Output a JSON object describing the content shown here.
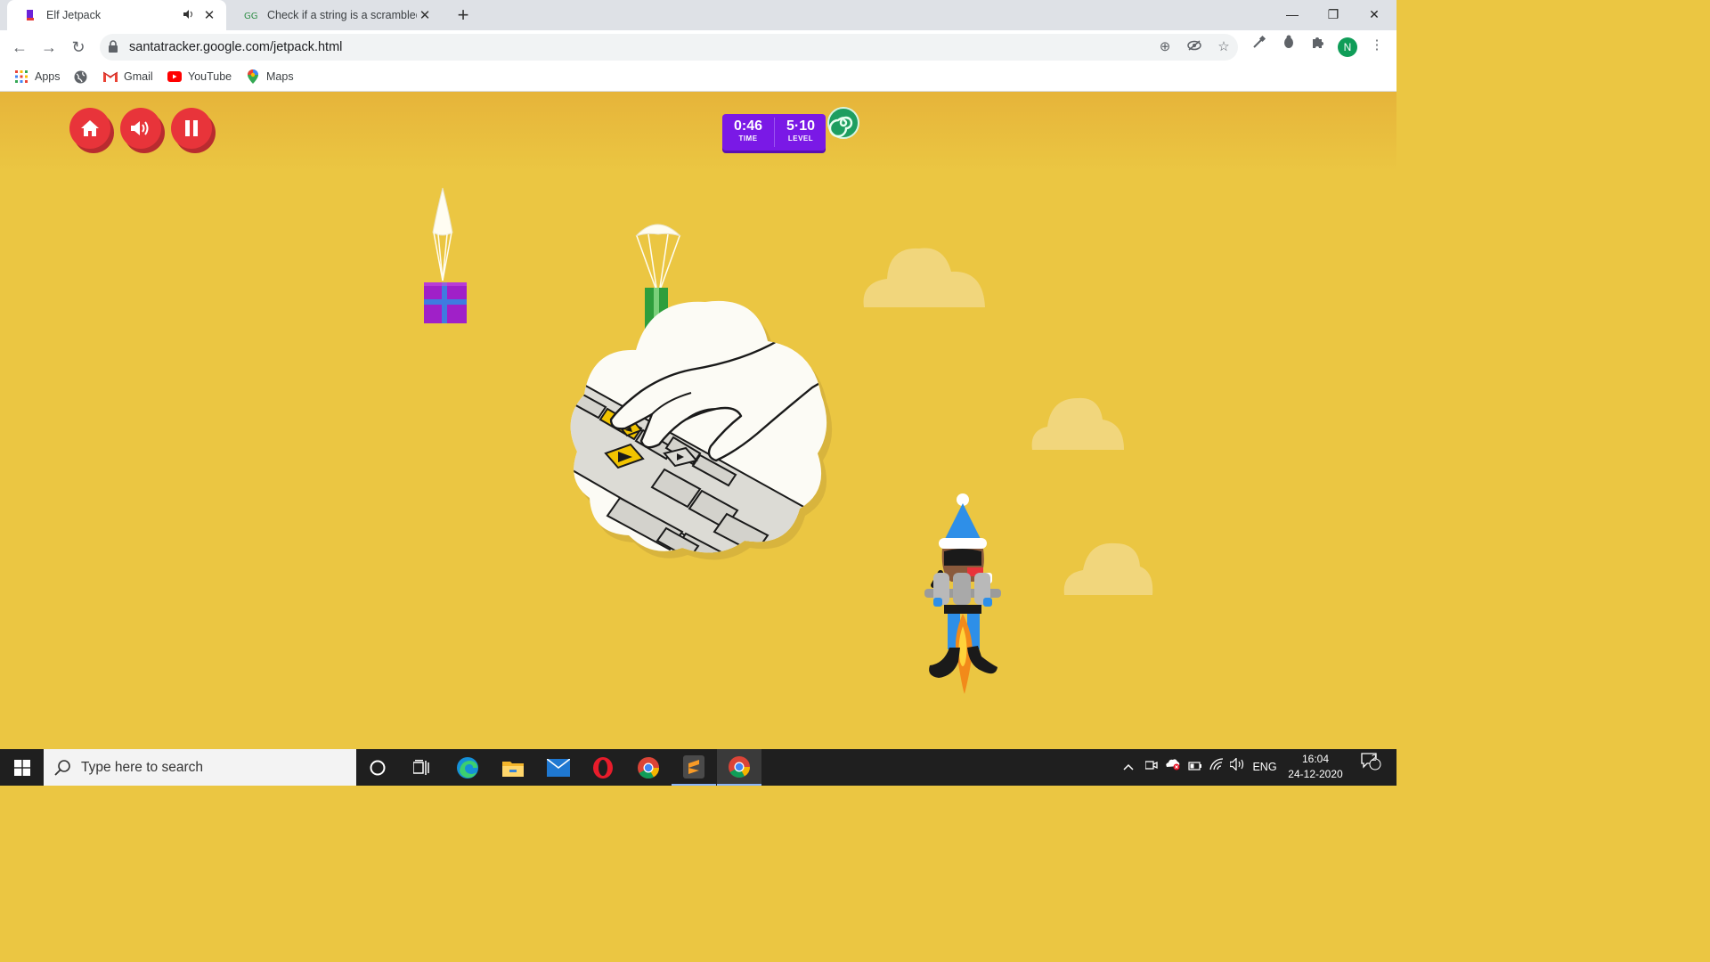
{
  "browser": {
    "tabs": [
      {
        "title": "Elf Jetpack",
        "active": true,
        "muted_icon": "speaker-icon"
      },
      {
        "title": "Check if a string is a scrambled fo",
        "active": false
      }
    ],
    "url": "santatracker.google.com/jetpack.html",
    "avatar_initial": "N",
    "bookmarks": [
      {
        "label": "Apps",
        "icon": "apps-grid-icon"
      },
      {
        "label": "",
        "icon": "globe-icon"
      },
      {
        "label": "Gmail",
        "icon": "gmail-icon"
      },
      {
        "label": "YouTube",
        "icon": "youtube-icon"
      },
      {
        "label": "Maps",
        "icon": "maps-pin-icon"
      }
    ]
  },
  "game": {
    "title": "Elf Jetpack",
    "buttons": [
      "home-icon",
      "sound-icon",
      "pause-icon"
    ],
    "hud": {
      "time_value": "0:46",
      "time_label": "TIME",
      "level_value": "5·10",
      "level_label": "LEVEL"
    },
    "colors": {
      "background": "#ebc642",
      "button": "#e8343a",
      "hud": "#7a19e6",
      "swirl": "#1e9e60"
    },
    "presents": [
      {
        "color": "#a020c8",
        "ribbon": "#3f7be0"
      },
      {
        "color": "#2e9e3c",
        "ribbon": "#7ad07a"
      }
    ]
  },
  "taskbar": {
    "search_placeholder": "Type here to search",
    "apps": [
      "cortana-icon",
      "task-view-icon",
      "edge-icon",
      "file-explorer-icon",
      "mail-icon",
      "opera-icon",
      "chrome-icon",
      "sublime-icon",
      "chrome-active-icon"
    ],
    "language": "ENG",
    "time": "16:04",
    "date": "24-12-2020",
    "notification_count": "2"
  }
}
